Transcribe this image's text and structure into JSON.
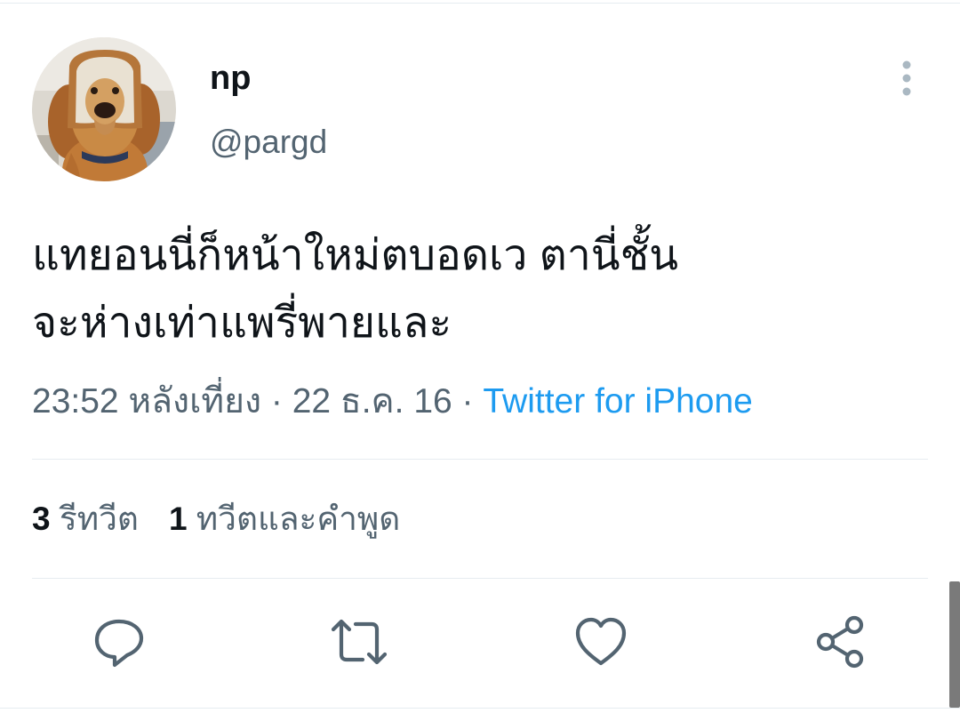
{
  "user": {
    "display_name": "np",
    "handle": "@pargd",
    "avatar": "dog-with-bread-avatar"
  },
  "tweet": {
    "text_lines": [
      "แทยอนนี่ก็หน้าใหม่ตบอดเว ตานี่ชั้น",
      "จะห่างเท่าแพรี่พายและ"
    ],
    "time": "23:52 หลังเที่ยง",
    "separator": "·",
    "date": "22 ธ.ค. 16",
    "source": "Twitter for iPhone"
  },
  "stats": {
    "retweets_count": "3",
    "retweets_label": "รีทวีต",
    "quotes_count": "1",
    "quotes_label": "ทวีตและคำพูด"
  },
  "actions": {
    "reply": "reply-icon",
    "retweet": "retweet-icon",
    "like": "heart-icon",
    "share": "share-icon",
    "more": "more-vertical-icon"
  },
  "colors": {
    "text": "#0f1419",
    "secondary": "#536471",
    "link": "#1d9bf0",
    "divider": "#e6ecf0"
  }
}
